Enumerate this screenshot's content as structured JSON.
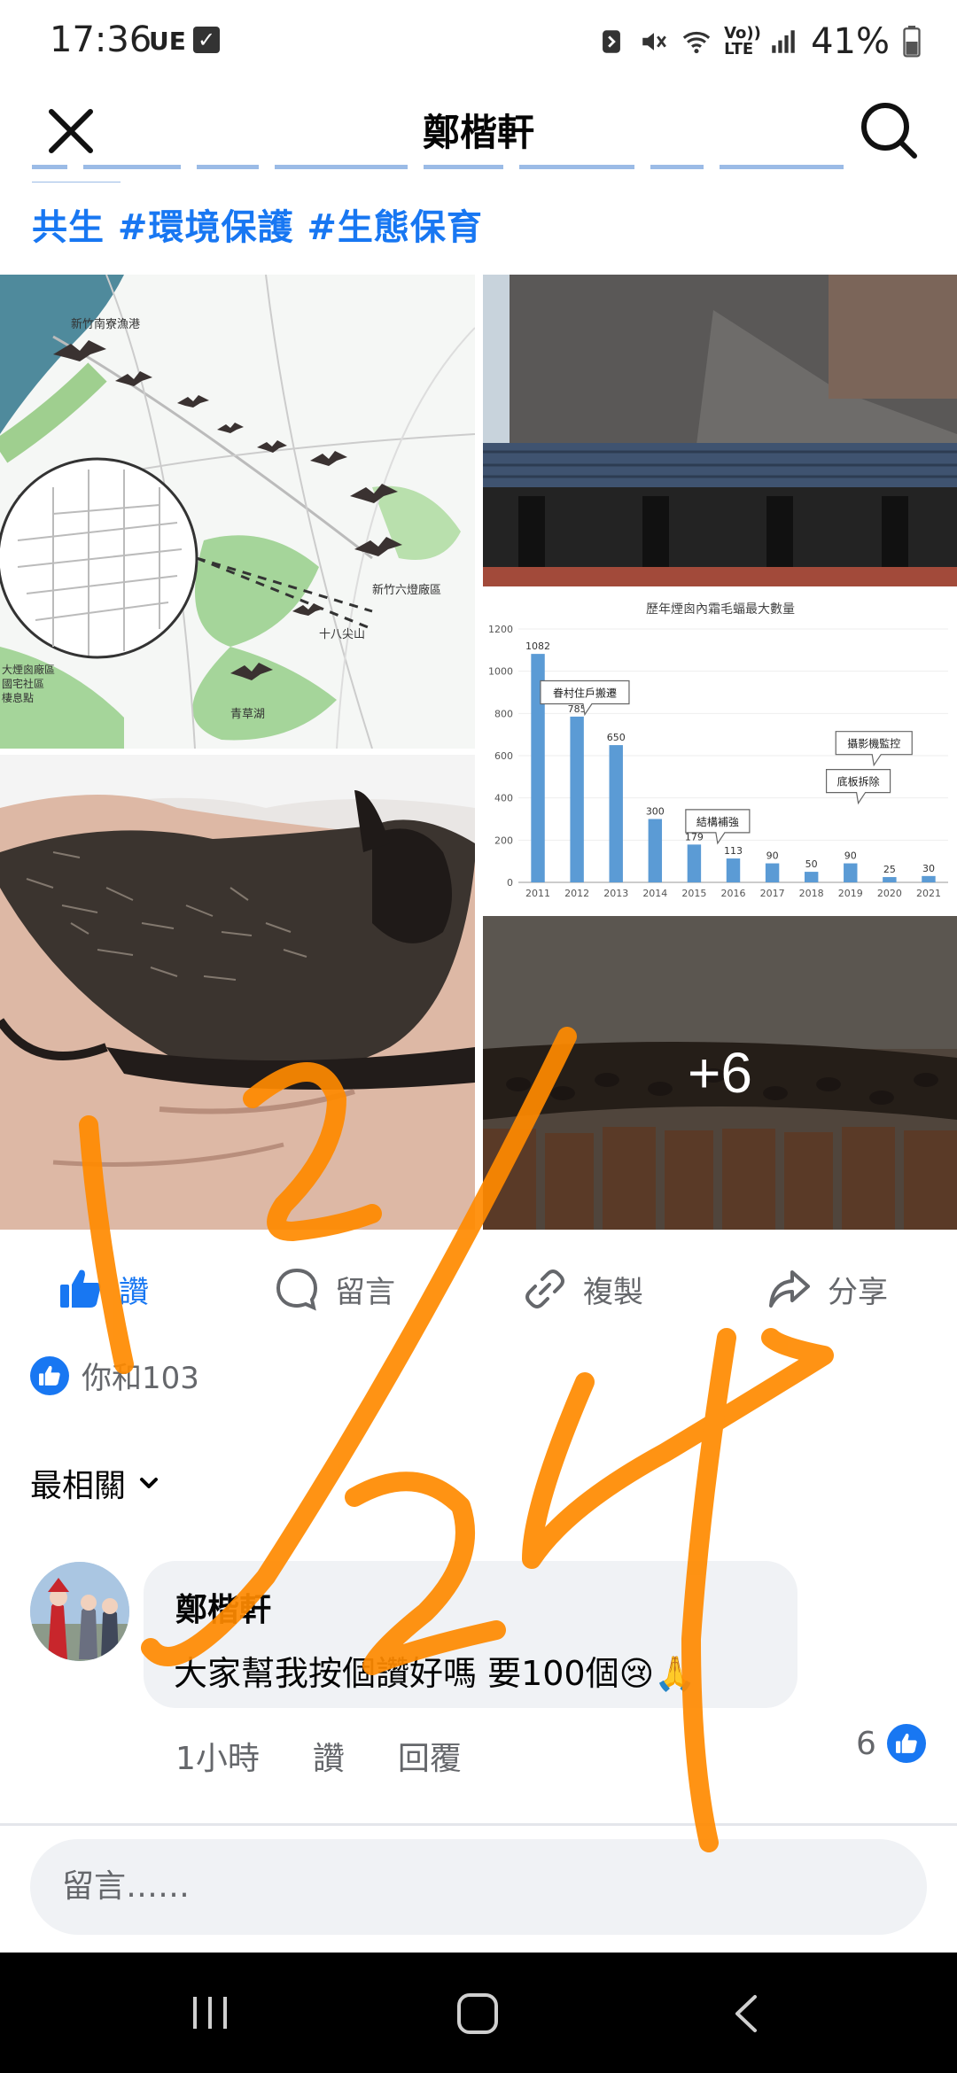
{
  "status_bar": {
    "time": "17:36",
    "carrier": "UE",
    "battery": "41%",
    "volte": "Vo)) LTE"
  },
  "header": {
    "title": "鄭楷軒"
  },
  "post": {
    "hashtags": "共生 #環境保護 #生態保育",
    "more_photos": "+6",
    "chart": {
      "title": "歷年煙囪內霜毛蝠最大數量",
      "callouts": [
        "眷村住戶搬遷",
        "結構補強",
        "攝影機監控",
        "底板拆除"
      ]
    },
    "map": {
      "labels": [
        "新竹南寮漁港",
        "新竹六燈廠區",
        "十八尖山",
        "青草湖",
        "大煙囪廠區",
        "國宅社區",
        "棲息點"
      ]
    }
  },
  "chart_data": {
    "type": "bar",
    "title": "歷年煙囪內霜毛蝠最大數量",
    "categories": [
      "2011",
      "2012",
      "2013",
      "2014",
      "2015",
      "2016",
      "2017",
      "2018",
      "2019",
      "2020",
      "2021"
    ],
    "values": [
      1082,
      785,
      650,
      300,
      179,
      113,
      90,
      50,
      90,
      25,
      30
    ],
    "ylim": [
      0,
      1200
    ],
    "yticks": [
      "0",
      "200",
      "400",
      "600",
      "800",
      "1000",
      "1200"
    ],
    "color": "#5B9BD5",
    "annotations": [
      "眷村住戶搬遷",
      "結構補強",
      "攝影機監控",
      "底板拆除"
    ]
  },
  "actions": {
    "like": "讚",
    "comment": "留言",
    "copy": "複製",
    "share": "分享"
  },
  "reactions": {
    "text": "你和103"
  },
  "comments": {
    "sort_label": "最相關",
    "items": [
      {
        "author": "鄭楷軒",
        "text": "大家幫我按個讚好嗎 要100個😢🙏",
        "time": "1小時",
        "like_label": "讚",
        "reply_label": "回覆",
        "likes": "6"
      }
    ]
  },
  "composer": {
    "placeholder": "留言……"
  },
  "colors": {
    "facebook_blue": "#1877F2",
    "scribble_orange": "#FF8A00",
    "bubble_grey": "#F0F2F5"
  }
}
